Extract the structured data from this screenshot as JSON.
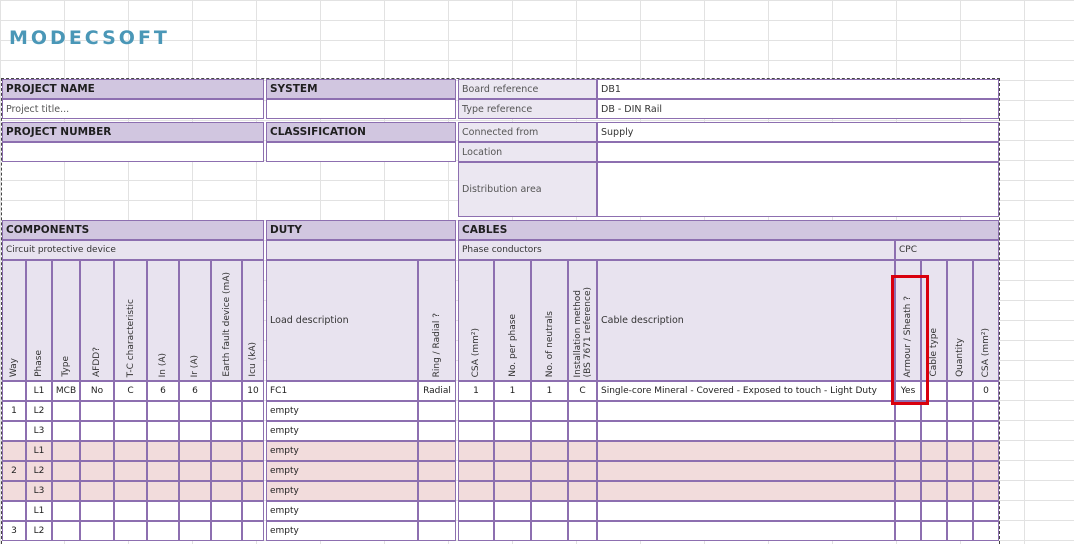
{
  "logo": "MODECSOFT",
  "project": {
    "name_label": "PROJECT NAME",
    "name_value": "Project title...",
    "number_label": "PROJECT NUMBER",
    "system_label": "SYSTEM",
    "classification_label": "CLASSIFICATION"
  },
  "board": {
    "board_ref_label": "Board reference",
    "board_ref_value": "DB1",
    "type_ref_label": "Type reference",
    "type_ref_value": "DB - DIN Rail",
    "connected_from_label": "Connected from",
    "connected_from_value": "Supply",
    "location_label": "Location",
    "distribution_area_label": "Distribution area"
  },
  "sections": {
    "components": "COMPONENTS",
    "duty": "DUTY",
    "cables": "CABLES",
    "circuit_protective_device": "Circuit protective device",
    "phase_conductors": "Phase conductors",
    "cpc": "CPC"
  },
  "columns": {
    "way": "Way",
    "phase": "Phase",
    "type": "Type",
    "afdd": "AFDD?",
    "tc": "T-C characteristic",
    "in": "In (A)",
    "ir": "Ir (A)",
    "earth_fault": "Earth fault device (mA)",
    "icu": "Icu (kA)",
    "load_description": "Load description",
    "ring_radial": "Ring / Radial ?",
    "csa": "CSA (mm²)",
    "no_per_phase": "No. per phase",
    "no_neutrals": "No. of neutrals",
    "installation_method_1": "Installation method",
    "installation_method_2": "(BS 7671 reference)",
    "cable_description": "Cable description",
    "armour_sheath": "Armour / Sheath ?",
    "cable_type": "Cable type",
    "quantity": "Quantity",
    "cpc_csa": "CSA (mm²)"
  },
  "rows": [
    {
      "way": "",
      "phase": "L1",
      "type": "MCB",
      "afdd": "No",
      "tc": "C",
      "in": "6",
      "ir": "6",
      "ef": "",
      "icu": "10",
      "load": "FC1",
      "ring": "Radial",
      "csa": "1",
      "npp": "1",
      "nn": "1",
      "im": "C",
      "cable": "Single-core Mineral - Covered - Exposed to touch - Light Duty",
      "armour": "Yes",
      "ctype": "",
      "qty": "",
      "ccsa": "0"
    },
    {
      "way": "1",
      "phase": "L2",
      "type": "",
      "afdd": "",
      "tc": "",
      "in": "",
      "ir": "",
      "ef": "",
      "icu": "",
      "load": "empty",
      "ring": "",
      "csa": "",
      "npp": "",
      "nn": "",
      "im": "",
      "cable": "",
      "armour": "",
      "ctype": "",
      "qty": "",
      "ccsa": ""
    },
    {
      "way": "",
      "phase": "L3",
      "type": "",
      "afdd": "",
      "tc": "",
      "in": "",
      "ir": "",
      "ef": "",
      "icu": "",
      "load": "empty",
      "ring": "",
      "csa": "",
      "npp": "",
      "nn": "",
      "im": "",
      "cable": "",
      "armour": "",
      "ctype": "",
      "qty": "",
      "ccsa": ""
    },
    {
      "way": "",
      "phase": "L1",
      "type": "",
      "afdd": "",
      "tc": "",
      "in": "",
      "ir": "",
      "ef": "",
      "icu": "",
      "load": "empty",
      "ring": "",
      "csa": "",
      "npp": "",
      "nn": "",
      "im": "",
      "cable": "",
      "armour": "",
      "ctype": "",
      "qty": "",
      "ccsa": ""
    },
    {
      "way": "2",
      "phase": "L2",
      "type": "",
      "afdd": "",
      "tc": "",
      "in": "",
      "ir": "",
      "ef": "",
      "icu": "",
      "load": "empty",
      "ring": "",
      "csa": "",
      "npp": "",
      "nn": "",
      "im": "",
      "cable": "",
      "armour": "",
      "ctype": "",
      "qty": "",
      "ccsa": ""
    },
    {
      "way": "",
      "phase": "L3",
      "type": "",
      "afdd": "",
      "tc": "",
      "in": "",
      "ir": "",
      "ef": "",
      "icu": "",
      "load": "empty",
      "ring": "",
      "csa": "",
      "npp": "",
      "nn": "",
      "im": "",
      "cable": "",
      "armour": "",
      "ctype": "",
      "qty": "",
      "ccsa": ""
    },
    {
      "way": "",
      "phase": "L1",
      "type": "",
      "afdd": "",
      "tc": "",
      "in": "",
      "ir": "",
      "ef": "",
      "icu": "",
      "load": "empty",
      "ring": "",
      "csa": "",
      "npp": "",
      "nn": "",
      "im": "",
      "cable": "",
      "armour": "",
      "ctype": "",
      "qty": "",
      "ccsa": ""
    },
    {
      "way": "3",
      "phase": "L2",
      "type": "",
      "afdd": "",
      "tc": "",
      "in": "",
      "ir": "",
      "ef": "",
      "icu": "",
      "load": "empty",
      "ring": "",
      "csa": "",
      "npp": "",
      "nn": "",
      "im": "",
      "cable": "",
      "armour": "",
      "ctype": "",
      "qty": "",
      "ccsa": ""
    }
  ],
  "row_group_colors": [
    "#ffffff",
    "#f2dcdc",
    "#ffffff"
  ],
  "annotation": {
    "highlight_color": "#d9000d",
    "highlighted_column": "Armour / Sheath ?"
  }
}
